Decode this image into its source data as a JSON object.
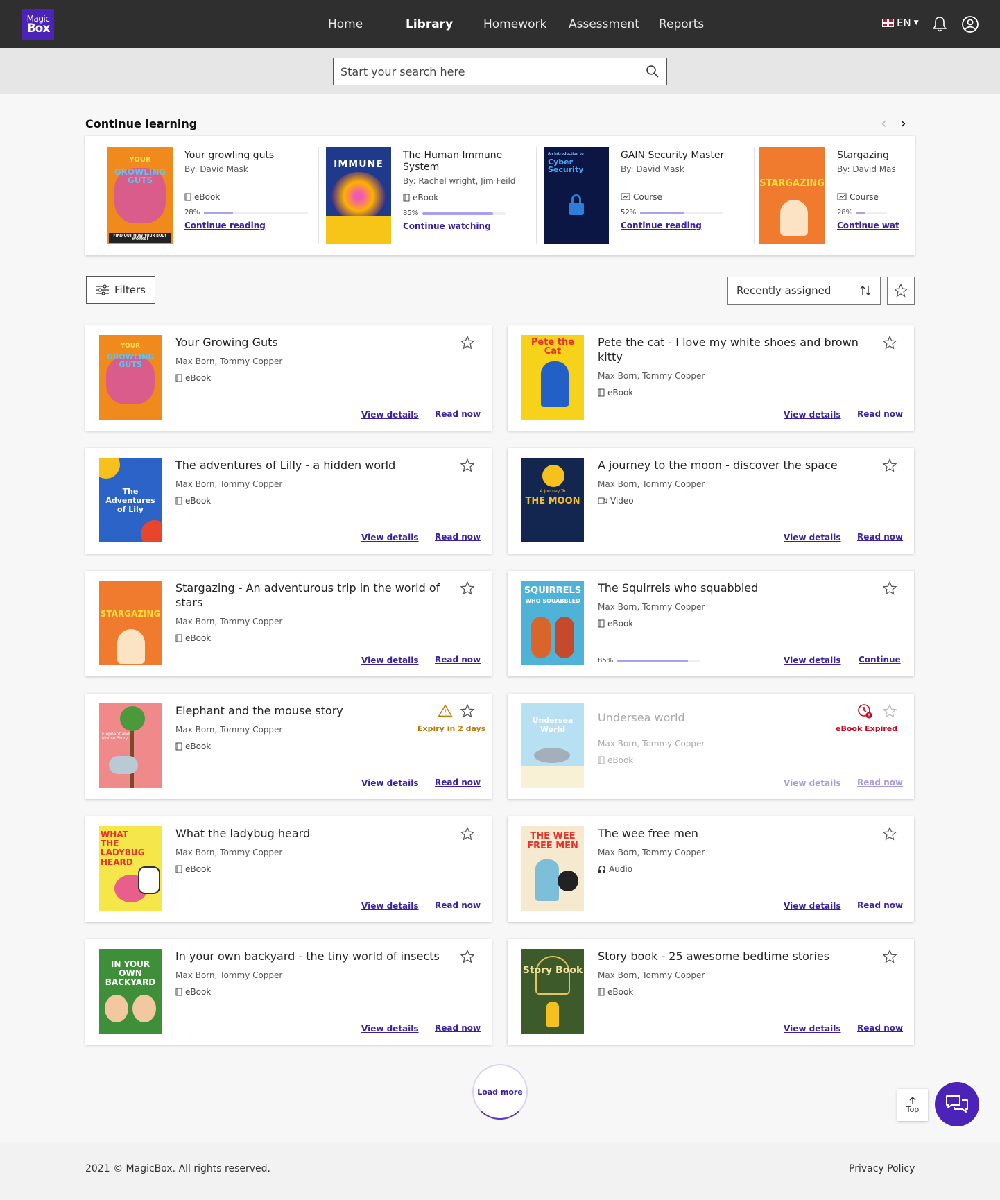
{
  "header": {
    "logo_line1": "Magic",
    "logo_line2": "Box",
    "nav": [
      "Home",
      "Library",
      "Homework",
      "Assessment",
      "Reports"
    ],
    "active_nav": "Library",
    "language": "EN"
  },
  "search": {
    "placeholder": "Start your search here"
  },
  "continue_learning": {
    "title": "Continue learning",
    "items": [
      {
        "title": "Your growling guts",
        "by": "By: David Mask",
        "type": "eBook",
        "progress": "28%",
        "progress_value": 0.28,
        "action": "Continue reading"
      },
      {
        "title": "The Human Immune System",
        "by": "By: Rachel wright, Jim Feild",
        "type": "eBook",
        "progress": "85%",
        "progress_value": 0.85,
        "action": "Continue watching"
      },
      {
        "title": "GAIN Security Master",
        "by": "By: David Mask",
        "type": "Course",
        "progress": "52%",
        "progress_value": 0.52,
        "action": "Continue reading"
      },
      {
        "title": "Stargazing",
        "by": "By: David Mas",
        "type": "Course",
        "progress": "28%",
        "progress_value": 0.28,
        "action": "Continue wat"
      }
    ],
    "cover_texts": {
      "immune": "IMMUNE",
      "cyber_intro": "An Introduction to",
      "cyber_title": "Cyber Security",
      "stargazing": "STARGAZING",
      "guts_top": "YOUR",
      "guts_mid": "GROWLING GUTS",
      "guts_sub": "FIND OUT HOW YOUR BODY WORKS!"
    }
  },
  "controls": {
    "filters_label": "Filters",
    "sort_label": "Recently assigned"
  },
  "cards": [
    {
      "title": "Your Growing Guts",
      "authors": "Max Born, Tommy Copper",
      "type": "eBook",
      "view": "View details",
      "action": "Read now"
    },
    {
      "title": "Pete the cat - I love my white shoes and brown kitty",
      "authors": "Max Born, Tommy Copper",
      "type": "eBook",
      "view": "View details",
      "action": "Read now"
    },
    {
      "title": "The adventures of Lilly  - a hidden world",
      "authors": "Max Born, Tommy Copper",
      "type": "eBook",
      "view": "View details",
      "action": "Read now"
    },
    {
      "title": "A journey to the moon - discover the space",
      "authors": "Max Born, Tommy Copper",
      "type": "Video",
      "view": "View details",
      "action": "Read now"
    },
    {
      "title": "Stargazing - An adventurous trip in the world of stars",
      "authors": "Max Born, Tommy Copper",
      "type": "eBook",
      "view": "View details",
      "action": "Read now"
    },
    {
      "title": "The Squirrels who squabbled",
      "authors": "Max Born, Tommy Copper",
      "type": "eBook",
      "progress": "85%",
      "progress_value": 0.85,
      "view": "View details",
      "action": "Continue"
    },
    {
      "title": "Elephant and the mouse story",
      "authors": "Max Born, Tommy Copper",
      "type": "eBook",
      "notice": "Expiry in 2 days",
      "view": "View details",
      "action": "Read now"
    },
    {
      "title": "Undersea world",
      "authors": "Max Born, Tommy Copper",
      "type": "eBook",
      "notice": "eBook Expired",
      "view": "View details",
      "action": "Read now"
    },
    {
      "title": "What the ladybug heard",
      "authors": "Max Born, Tommy Copper",
      "type": "eBook",
      "view": "View details",
      "action": "Read now"
    },
    {
      "title": "The wee free men",
      "authors": "Max Born, Tommy Copper",
      "type": "Audio",
      "view": "View details",
      "action": "Read now"
    },
    {
      "title": "In your own backyard - the tiny world of insects",
      "authors": "Max Born, Tommy Copper",
      "type": "eBook",
      "view": "View details",
      "action": "Read now"
    },
    {
      "title": "Story book - 25 awesome bedtime stories",
      "authors": "Max Born, Tommy Copper",
      "type": "eBook",
      "view": "View details",
      "action": "Read now"
    }
  ],
  "cover_labels": {
    "pete": "Pete the Cat",
    "lilly": "The Adventures of Lily",
    "moon_small": "A Journey To",
    "moon": "THE MOON",
    "squirrels": "SQUIRRELS",
    "squirrels_sub": "WHO SQUABBLED",
    "undersea": "Undersea World",
    "ladybug": "WHAT THE LADYBUG HEARD",
    "wee": "THE WEE FREE MEN",
    "backyard": "IN YOUR OWN BACKYARD",
    "story": "Story Book",
    "elephant": "Elephant and Mouse Story"
  },
  "load_more": "Load more",
  "top_label": "Top",
  "footer": {
    "copyright": "2021 © MagicBox. All rights reserved.",
    "privacy": "Privacy Policy"
  },
  "colors": {
    "brand": "#4b23b8",
    "header_bg": "#2f2f2f",
    "link": "#3b1fa5",
    "progress": "#a7a2f0",
    "warning": "#c27a00",
    "expired": "#d0021b"
  }
}
